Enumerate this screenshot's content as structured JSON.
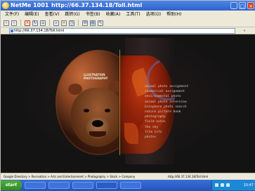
{
  "window": {
    "title": "NetMe 1001",
    "title_url": "http://66.37.134.18/Toll.html"
  },
  "menubar": {
    "items": [
      "文件(F)",
      "编辑(E)",
      "查看(V)",
      "跳转(G)",
      "书签(B)",
      "收藏(A)",
      "工具(T)",
      "选项(O)",
      "帮助(H)"
    ]
  },
  "toolbar": {
    "icons": [
      "back-icon",
      "forward-icon",
      "stop-icon",
      "refresh-icon",
      "home-icon",
      "search-icon",
      "favorites-icon",
      "history-icon",
      "mail-icon",
      "print-icon",
      "edit-icon"
    ]
  },
  "addressbar": {
    "label": "",
    "value": "http://66.37.134.18/Toll.html",
    "go_label": "»"
  },
  "content": {
    "stamp_lines": [
      "LLUSTRATION",
      "PHOTOGRAPHY"
    ],
    "nav_items": [
      "animal photo assignment",
      "commercial assignment",
      "environmental photo",
      "animal photo interview",
      "biosphere photo search",
      "nature picture book",
      "photography",
      "field notes",
      "the sky",
      "film info",
      "photos"
    ]
  },
  "statusbar": {
    "breadcrumb": "Google Directory > Recreation > Arts and Entertainment > Photography > Stock > Company",
    "url": "http://66.37.134.18/Toll.html"
  },
  "taskbar": {
    "start_label": "start",
    "clock": "10:47"
  },
  "colors": {
    "title_bar": "#2e62c8",
    "content_bg": "#141314",
    "nav_text": "#c9c9c9",
    "taskbar": "#2453b8",
    "start_button": "#2f8a22"
  }
}
